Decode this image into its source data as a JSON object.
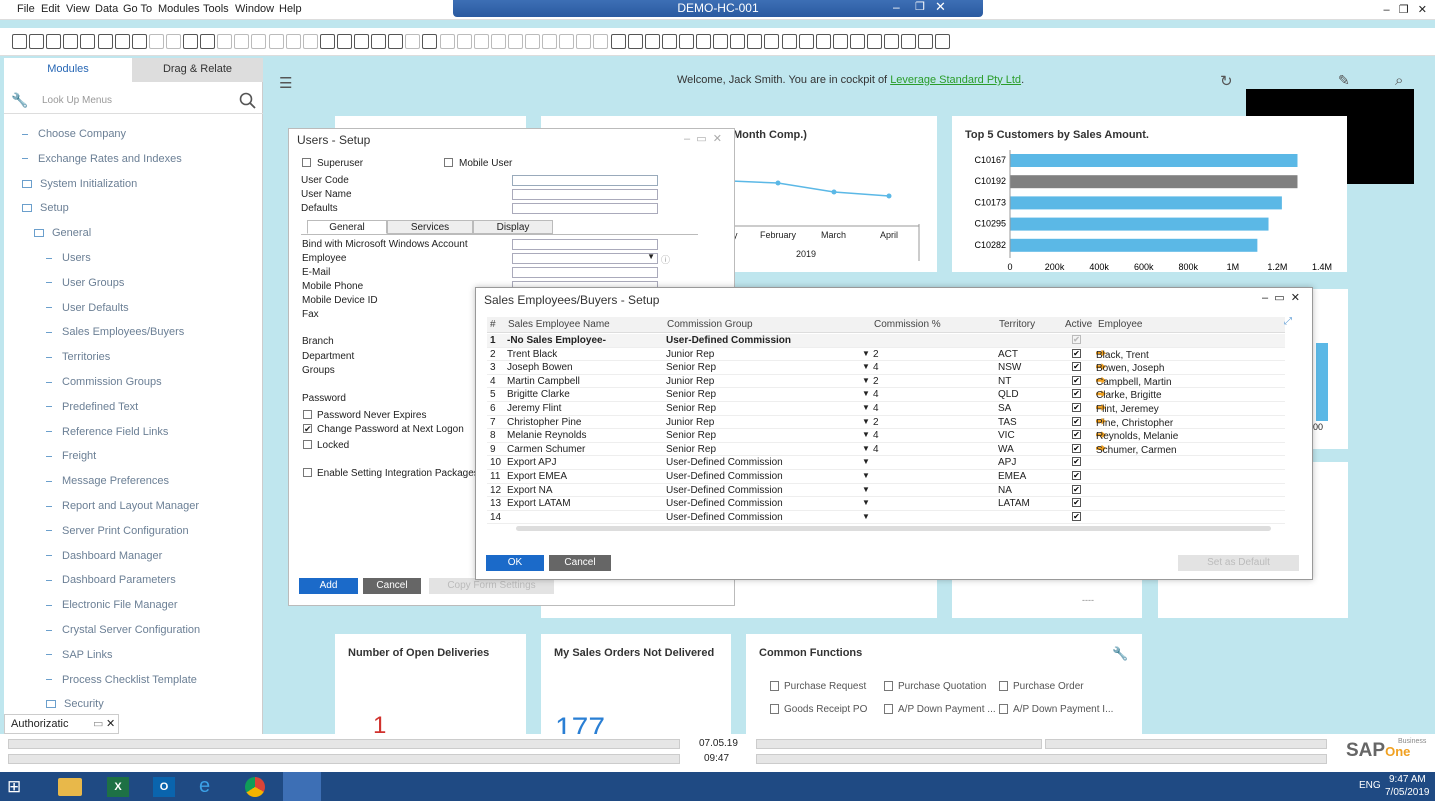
{
  "menu": [
    "File",
    "Edit",
    "View",
    "Data",
    "Go To",
    "Modules",
    "Tools",
    "Window",
    "Help"
  ],
  "window_title": "DEMO-HC-001",
  "left_panel": {
    "tab_modules": "Modules",
    "tab_drag": "Drag & Relate",
    "lookup_placeholder": "Look Up Menus",
    "items": [
      {
        "label": "Choose Company",
        "type": "dash",
        "indent": 0
      },
      {
        "label": "Exchange Rates and Indexes",
        "type": "dash",
        "indent": 0
      },
      {
        "label": "System Initialization",
        "type": "folder",
        "indent": 0
      },
      {
        "label": "Setup",
        "type": "folder",
        "indent": 0
      },
      {
        "label": "General",
        "type": "folder",
        "indent": 1
      },
      {
        "label": "Users",
        "type": "dash",
        "indent": 2
      },
      {
        "label": "User Groups",
        "type": "dash",
        "indent": 2
      },
      {
        "label": "User Defaults",
        "type": "dash",
        "indent": 2
      },
      {
        "label": "Sales Employees/Buyers",
        "type": "dash",
        "indent": 2
      },
      {
        "label": "Territories",
        "type": "dash",
        "indent": 2
      },
      {
        "label": "Commission Groups",
        "type": "dash",
        "indent": 2
      },
      {
        "label": "Predefined Text",
        "type": "dash",
        "indent": 2
      },
      {
        "label": "Reference Field Links",
        "type": "dash",
        "indent": 2
      },
      {
        "label": "Freight",
        "type": "dash",
        "indent": 2
      },
      {
        "label": "Message Preferences",
        "type": "dash",
        "indent": 2
      },
      {
        "label": "Report and Layout Manager",
        "type": "dash",
        "indent": 2
      },
      {
        "label": "Server Print Configuration",
        "type": "dash",
        "indent": 2
      },
      {
        "label": "Dashboard Manager",
        "type": "dash",
        "indent": 2
      },
      {
        "label": "Dashboard Parameters",
        "type": "dash",
        "indent": 2
      },
      {
        "label": "Electronic File Manager",
        "type": "dash",
        "indent": 2
      },
      {
        "label": "Crystal Server Configuration",
        "type": "dash",
        "indent": 2
      },
      {
        "label": "SAP Links",
        "type": "dash",
        "indent": 2
      },
      {
        "label": "Process Checklist Template",
        "type": "dash",
        "indent": 2
      },
      {
        "label": "Security",
        "type": "folder",
        "indent": 2
      }
    ],
    "bottom_tab": "Authorizatic"
  },
  "cockpit": {
    "welcome": "Welcome, Jack Smith. You are in cockpit of ",
    "company": "Leverage Standard Pty Ltd",
    "welcome_end": ".",
    "card_month_title": "Month Comp.)",
    "card_top5_title": "Top 5 Customers by Sales Amount.",
    "card_deliveries_title": "Number of Open Deliveries",
    "deliveries_value": "1",
    "card_orders_title": "My Sales Orders Not Delivered",
    "orders_value": "177",
    "card_common_title": "Common Functions",
    "common": [
      "Purchase Request",
      "Purchase Quotation",
      "Purchase Order",
      "Goods Receipt PO",
      "A/P Down Payment ...",
      "A/P Down Payment I..."
    ],
    "right_tick": "00",
    "dash_mark": "----"
  },
  "line_chart": {
    "months": [
      "y",
      "February",
      "March",
      "April"
    ],
    "year": "2019"
  },
  "chart_data": {
    "type": "bar",
    "title": "Top 5 Customers by Sales Amount.",
    "categories": [
      "C10167",
      "C10192",
      "C10173",
      "C10295",
      "C10282"
    ],
    "values": [
      1290000,
      1290000,
      1220000,
      1160000,
      1110000
    ],
    "xticks": [
      "0",
      "200k",
      "400k",
      "600k",
      "800k",
      "1M",
      "1.2M",
      "1.4M"
    ],
    "xlim": [
      0,
      1400000
    ],
    "colors": [
      "#5bb8e6",
      "#808080",
      "#5bb8e6",
      "#5bb8e6",
      "#5bb8e6"
    ]
  },
  "users_dialog": {
    "title": "Users - Setup",
    "superuser": "Superuser",
    "mobile_user": "Mobile User",
    "user_code": "User Code",
    "user_name": "User Name",
    "defaults": "Defaults",
    "tabs": [
      "General",
      "Services",
      "Display"
    ],
    "fields": [
      "Bind with Microsoft Windows Account",
      "Employee",
      "E-Mail",
      "Mobile Phone",
      "Mobile Device ID",
      "Fax",
      "Branch",
      "Department",
      "Groups",
      "Password"
    ],
    "pw_never": "Password Never Expires",
    "change_pw": "Change Password at Next Logon",
    "locked": "Locked",
    "integration": "Enable Setting Integration Packages",
    "add": "Add",
    "cancel": "Cancel",
    "copy": "Copy Form Settings"
  },
  "sales_dialog": {
    "title": "Sales Employees/Buyers - Setup",
    "headers": [
      "#",
      "Sales Employee Name",
      "Commission Group",
      "Commission %",
      "Territory",
      "Active",
      "Employee"
    ],
    "rows": [
      {
        "n": "1",
        "name": "-No Sales Employee-",
        "group": "User-Defined Commission",
        "pct": "",
        "terr": "",
        "emp": "",
        "bold": true
      },
      {
        "n": "2",
        "name": "Trent Black",
        "group": "Junior Rep",
        "pct": "2",
        "terr": "ACT",
        "emp": "Black, Trent"
      },
      {
        "n": "3",
        "name": "Joseph Bowen",
        "group": "Senior Rep",
        "pct": "4",
        "terr": "NSW",
        "emp": "Bowen, Joseph"
      },
      {
        "n": "4",
        "name": "Martin Campbell",
        "group": "Junior Rep",
        "pct": "2",
        "terr": "NT",
        "emp": "Campbell, Martin"
      },
      {
        "n": "5",
        "name": "Brigitte Clarke",
        "group": "Senior Rep",
        "pct": "4",
        "terr": "QLD",
        "emp": "Clarke, Brigitte"
      },
      {
        "n": "6",
        "name": "Jeremy Flint",
        "group": "Senior Rep",
        "pct": "4",
        "terr": "SA",
        "emp": "Flint, Jeremey"
      },
      {
        "n": "7",
        "name": "Christopher Pine",
        "group": "Junior Rep",
        "pct": "2",
        "terr": "TAS",
        "emp": "Pine, Christopher"
      },
      {
        "n": "8",
        "name": "Melanie Reynolds",
        "group": "Senior Rep",
        "pct": "4",
        "terr": "VIC",
        "emp": "Reynolds, Melanie"
      },
      {
        "n": "9",
        "name": "Carmen Schumer",
        "group": "Senior Rep",
        "pct": "4",
        "terr": "WA",
        "emp": "Schumer, Carmen"
      },
      {
        "n": "10",
        "name": "Export APJ",
        "group": "User-Defined Commission",
        "pct": "",
        "terr": "APJ",
        "emp": ""
      },
      {
        "n": "11",
        "name": "Export EMEA",
        "group": "User-Defined Commission",
        "pct": "",
        "terr": "EMEA",
        "emp": ""
      },
      {
        "n": "12",
        "name": "Export NA",
        "group": "User-Defined Commission",
        "pct": "",
        "terr": "NA",
        "emp": ""
      },
      {
        "n": "13",
        "name": "Export LATAM",
        "group": "User-Defined Commission",
        "pct": "",
        "terr": "LATAM",
        "emp": ""
      },
      {
        "n": "14",
        "name": "",
        "group": "User-Defined Commission",
        "pct": "",
        "terr": "",
        "emp": ""
      }
    ],
    "ok": "OK",
    "cancel": "Cancel",
    "set_default": "Set as Default"
  },
  "status": {
    "date": "07.05.19",
    "time": "09:47",
    "brand": "SAP",
    "brand_one": "One",
    "brand_sub": "Business"
  },
  "taskbar": {
    "lang": "ENG",
    "time": "9:47 AM",
    "date": "7/05/2019"
  }
}
